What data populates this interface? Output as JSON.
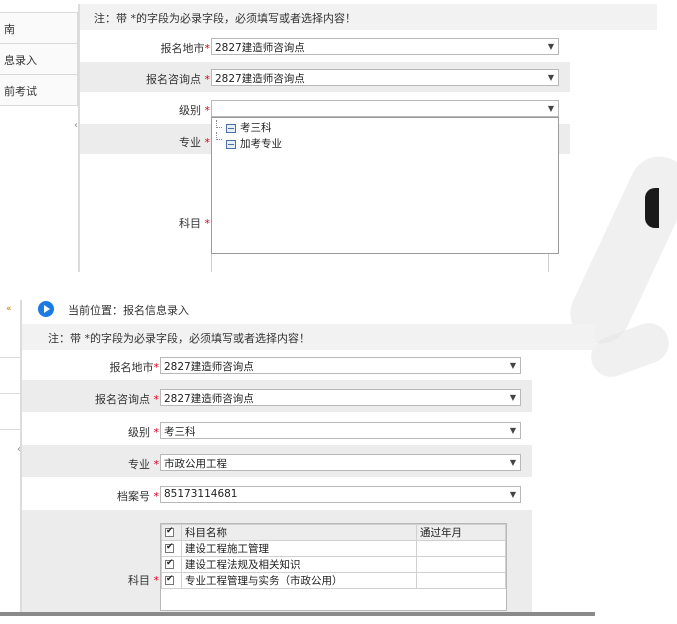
{
  "top": {
    "side_nav": [
      "南",
      "息录入",
      "前考试"
    ],
    "notice": "注：带 *的字段为必录字段，必须填写或者选择内容！",
    "fields": {
      "city": {
        "label": "报名地市",
        "value": "2827建造师咨询点"
      },
      "point": {
        "label": "报名咨询点 ",
        "value": "2827建造师咨询点"
      },
      "level": {
        "label": "级别 ",
        "value": ""
      },
      "major": {
        "label": "专业 "
      },
      "subject": {
        "label": "科目 "
      }
    },
    "dropdown_options": [
      "考三科",
      "加考专业"
    ]
  },
  "bottom": {
    "breadcrumb": "当前位置：报名信息录入",
    "notice": "注：带 *的字段为必录字段，必须填写或者选择内容！",
    "fields": {
      "city": {
        "label": "报名地市",
        "value": "2827建造师咨询点"
      },
      "point": {
        "label": "报名咨询点 ",
        "value": "2827建造师咨询点"
      },
      "level": {
        "label": "级别 ",
        "value": "考三科"
      },
      "major": {
        "label": "专业 ",
        "value": "市政公用工程"
      },
      "file_no": {
        "label": "档案号 ",
        "value": "85173114681"
      },
      "subject": {
        "label": "科目 "
      }
    },
    "subject_table": {
      "headers": [
        "科目名称",
        "通过年月"
      ],
      "rows": [
        {
          "name": "建设工程施工管理",
          "passed": ""
        },
        {
          "name": "建设工程法规及相关知识",
          "passed": ""
        },
        {
          "name": "专业工程管理与实务（市政公用）",
          "passed": ""
        }
      ]
    }
  },
  "required_mark": "*",
  "colors": {
    "accent": "#1a7be3",
    "required": "#d9001b"
  }
}
